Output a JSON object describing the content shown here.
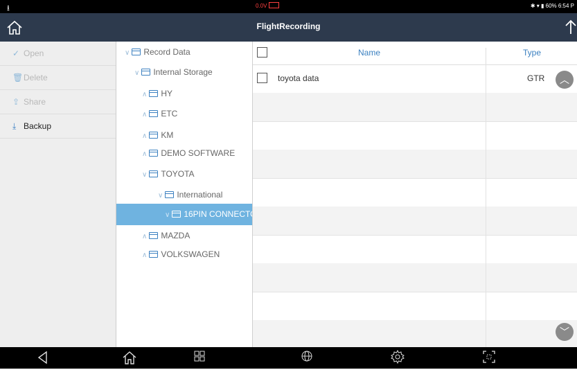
{
  "status": {
    "left_icon": "usb-icon",
    "voltage": "0.0V",
    "right": "✱ ▾ ▮ 60% 6:54 P"
  },
  "appbar": {
    "title": "FlightRecording"
  },
  "sidebar": {
    "items": [
      {
        "label": "Open",
        "icon": "✓",
        "active": false
      },
      {
        "label": "Delete",
        "icon": "🗑",
        "active": false
      },
      {
        "label": "Share",
        "icon": "⇪",
        "active": false
      },
      {
        "label": "Backup",
        "icon": "⤓",
        "active": true
      }
    ]
  },
  "tree": {
    "nodes": [
      {
        "label": "Record Data",
        "chev": "∨"
      },
      {
        "label": "Internal Storage",
        "chev": "∨"
      },
      {
        "label": "HY",
        "chev": "∧"
      },
      {
        "label": "ETC",
        "chev": "∧"
      },
      {
        "label": "KM",
        "chev": "∧"
      },
      {
        "label": "DEMO SOFTWARE",
        "chev": "∧"
      },
      {
        "label": "TOYOTA",
        "chev": "∨"
      },
      {
        "label": "International",
        "chev": "∨"
      },
      {
        "label": "16PIN CONNECTO",
        "chev": "∨"
      },
      {
        "label": "MAZDA",
        "chev": "∧"
      },
      {
        "label": "VOLKSWAGEN",
        "chev": "∧"
      }
    ]
  },
  "table": {
    "headers": {
      "name": "Name",
      "type": "Type"
    },
    "rows": [
      {
        "name": "toyota data",
        "type": "GTR"
      }
    ]
  },
  "colors": {
    "appbar": "#2d3a4d",
    "accent": "#3b80c0",
    "selected": "#6fb3e0"
  }
}
